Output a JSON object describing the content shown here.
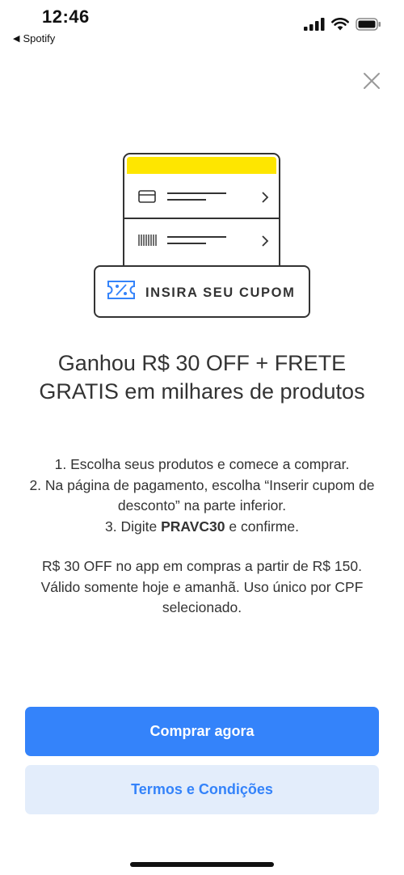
{
  "status_bar": {
    "time": "12:46",
    "back_app": "Spotify",
    "back_arrow": "◀"
  },
  "illustration": {
    "coupon_label": "INSIRA SEU CUPOM",
    "accent_color": "#fee600",
    "coupon_icon_color": "#3483fa"
  },
  "promo": {
    "headline": "Ganhou R$ 30 OFF + FRETE GRATIS em milhares de produtos",
    "step1": "1. Escolha seus produtos e comece a comprar.",
    "step2": "2. Na página de pagamento, escolha “Inserir cupom de desconto” na parte inferior.",
    "step3_prefix": "3. Digite ",
    "step3_code": "PRAVC30",
    "step3_suffix": " e confirme.",
    "note": "R$ 30 OFF no app em compras a partir de R$ 150. Válido somente hoje e amanhã. Uso único por CPF selecionado."
  },
  "actions": {
    "primary_label": "Comprar agora",
    "secondary_label": "Termos e Condições"
  },
  "colors": {
    "primary": "#3483fa",
    "secondary_bg": "#e3edfb",
    "text": "#333333"
  }
}
